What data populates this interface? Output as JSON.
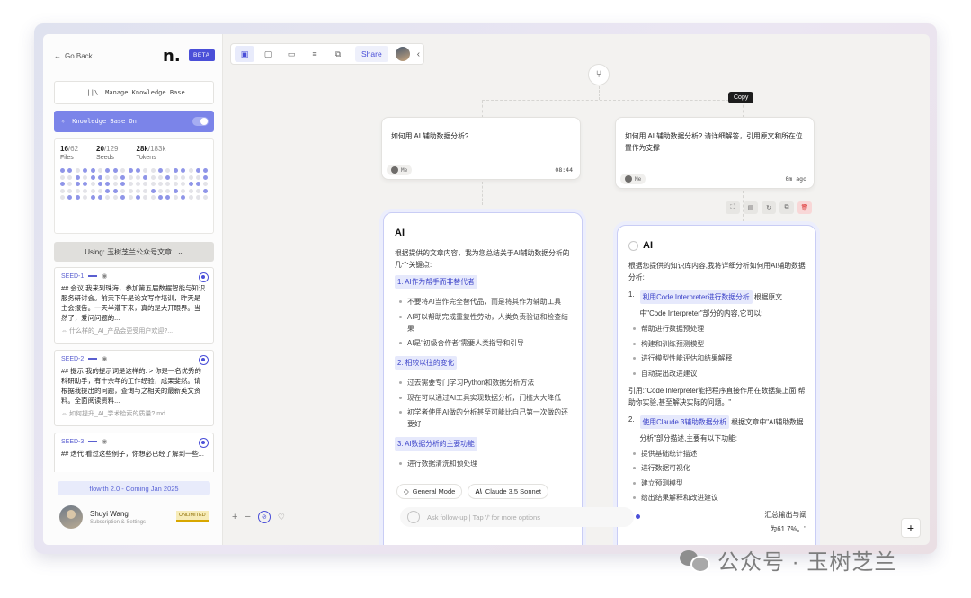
{
  "sidebar": {
    "back": "Go Back",
    "logo": "n.",
    "beta": "BETA",
    "manage": "Manage Knowledge Base",
    "kb_on": "Knowledge Base On",
    "stats": {
      "files_n": "16",
      "files_t": "/62",
      "files_l": "Files",
      "seeds_n": "20",
      "seeds_t": "/129",
      "seeds_l": "Seeds",
      "tokens_n": "28k",
      "tokens_t": "/183k",
      "tokens_l": "Tokens"
    },
    "using": "Using: 玉树芝兰公众号文章",
    "seeds": [
      {
        "title": "SEED-1",
        "body": "## 会议 我来到珠海，参加第五届数据智能与知识服务研讨会。前天下午是论文写作培训，昨天是主会报告。一天半灌下来，真的是大开眼界。当然了，爱问问题的...",
        "link": "什么样的_AI_产品会更受用户欢迎?..."
      },
      {
        "title": "SEED-2",
        "body": "## 提示 我的提示词是这样的: > 你是一名优秀的科研助手，有十余年的工作经验，成果斐然。请根据我提出的问题，查询与之相关的最新英文资料。全面阅读资料...",
        "link": "如何提升_AI_学术检索的质量?.md"
      },
      {
        "title": "SEED-3",
        "body": "## 迭代 看过这些例子，你想必已经了解到一些...",
        "link": ""
      }
    ],
    "coming": "flowith 2.0 - Coming Jan 2025",
    "user_name": "Shuyi Wang",
    "user_sub": "Subscription & Settings",
    "badge": "UNLIMITED"
  },
  "toolbar": {
    "share": "Share"
  },
  "canvas": {
    "tooltip": "Copy",
    "q1": {
      "text": "如何用 AI 辅助数据分析?",
      "who": "Me",
      "time": "08:44"
    },
    "q2": {
      "text": "如何用 AI 辅助数据分析? 请详细解答，引用原文和所在位置作为支撑",
      "who": "Me",
      "time": "0m ago"
    },
    "a1": {
      "title": "AI",
      "intro": "根据提供的文章内容，我为您总结关于AI辅助数据分析的几个关键点:",
      "s1": "1. AI作为帮手而非替代者",
      "s1_items": [
        "不要将AI当作完全替代品，而是将其作为辅助工具",
        "AI可以帮助完成重复性劳动，人类负责验证和检查结果",
        "AI是\"初级合作者\"需要人类指导和引导"
      ],
      "s2": "2. 相较以往的变化",
      "s2_items": [
        "过去需要专门学习Python和数据分析方法",
        "现在可以通过AI工具实现数据分析，门槛大大降低",
        "初学者使用AI做的分析甚至可能比自己第一次做的还要好"
      ],
      "s3": "3. AI数据分析的主要功能",
      "s3_items": [
        "进行数据清洗和预处理"
      ]
    },
    "a2": {
      "title": "AI",
      "intro": "根据您提供的知识库内容,我将详细分析如何用AI辅助数据分析:",
      "n1": "1.",
      "s1": "利用Code Interpreter进行数据分析",
      "s1_rest": "根据原文中\"Code Interpreter\"部分的内容,它可以:",
      "s1_items": [
        "帮助进行数据预处理",
        "构建和训练预测模型",
        "进行模型性能评估和结果解释",
        "自动提出改进建议"
      ],
      "quote": "引用:\"Code Interpreter能把程序直接作用在数据集上面,帮助你实验,甚至解决实际的问题。\"",
      "n2": "2.",
      "s2": "使用Claude 3辅助数据分析",
      "s2_rest": "根据文章中\"AI辅助数据分析\"部分描述,主要有以下功能:",
      "s2_items": [
        "提供基础统计描述",
        "进行数据可视化",
        "建立预测模型",
        "给出结果解释和改进建议"
      ],
      "tail1": "汇总输出与阐",
      "tail2": "为61.7%。\""
    },
    "mode": "General Mode",
    "model": "Claude 3.5 Sonnet",
    "ask": "Ask follow-up | Tap '/' for more options"
  },
  "watermark": "公众号 · 玉树芝兰",
  "colors": {
    "accent": "#4a4fd8",
    "kb_bar": "#7b84e9"
  }
}
